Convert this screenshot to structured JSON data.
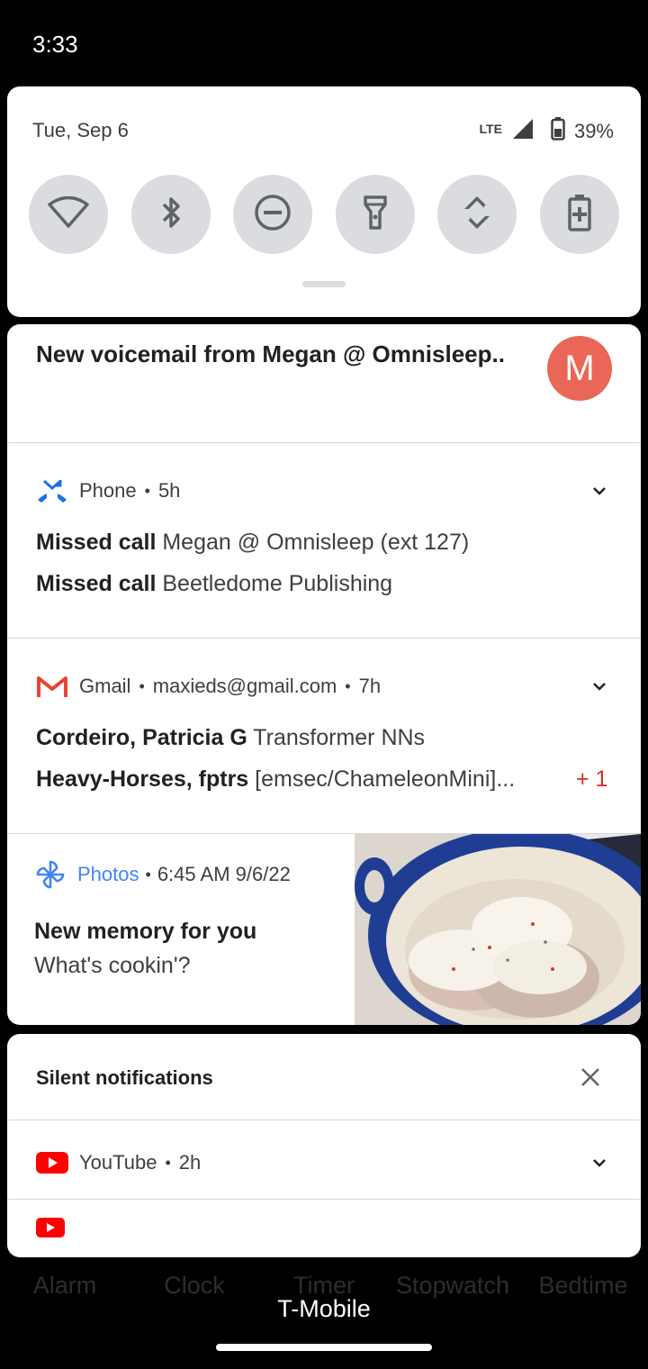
{
  "status_bar": {
    "time": "3:33"
  },
  "quick_settings": {
    "date": "Tue, Sep 6",
    "network": "LTE",
    "battery": "39%",
    "tiles": [
      {
        "icon": "wifi-icon"
      },
      {
        "icon": "bluetooth-icon"
      },
      {
        "icon": "do-not-disturb-icon"
      },
      {
        "icon": "flashlight-icon"
      },
      {
        "icon": "auto-rotate-icon"
      },
      {
        "icon": "battery-saver-icon"
      }
    ]
  },
  "notifications": {
    "voicemail": {
      "title": "New voicemail from Megan @ Omnisleep..",
      "avatar_letter": "M",
      "avatar_color": "#ea6757"
    },
    "phone": {
      "app": "Phone",
      "time": "5h",
      "lines": [
        {
          "bold": "Missed call",
          "text": "Megan @ Omnisleep (ext 127)"
        },
        {
          "bold": "Missed call",
          "text": "Beetledome Publishing"
        }
      ]
    },
    "gmail": {
      "app": "Gmail",
      "account": "maxieds@gmail.com",
      "time": "7h",
      "lines": [
        {
          "bold": "Cordeiro, Patricia G",
          "text": "Transformer NNs"
        },
        {
          "bold": "Heavy-Horses, fptrs",
          "text": "[emsec/ChameleonMini]..."
        }
      ],
      "extra": "+ 1"
    },
    "photos": {
      "app": "Photos",
      "app_color": "#4285f4",
      "time": "6:45 AM 9/6/22",
      "title": "New memory for you",
      "subtitle": "What's cookin'?"
    }
  },
  "silent": {
    "title": "Silent notifications",
    "youtube": {
      "app": "YouTube",
      "time": "2h"
    }
  },
  "background_tabs": [
    "Alarm",
    "Clock",
    "Timer",
    "Stopwatch",
    "Bedtime"
  ],
  "carrier": "T-Mobile",
  "separator": "•"
}
